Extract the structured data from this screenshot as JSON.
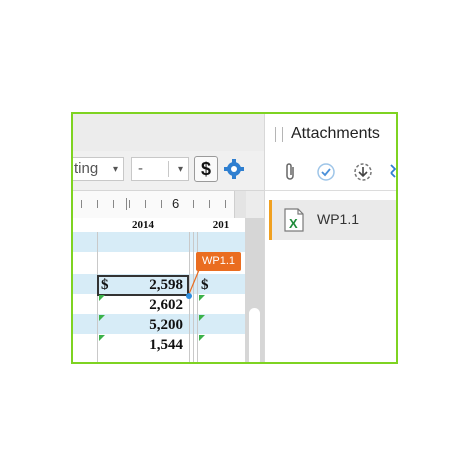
{
  "toolbar": {
    "format_select_value": "ting",
    "dash_select_value": "-",
    "currency_button_label": "$",
    "dropdown_arrow": "▾"
  },
  "ruler": {
    "marker": "6"
  },
  "sheet": {
    "columns": [
      "2014",
      "201"
    ],
    "cells": [
      {
        "prefix": "$",
        "value": "2,598",
        "right_prefix": "$"
      },
      {
        "prefix": "",
        "value": "2,602"
      },
      {
        "prefix": "",
        "value": "5,200"
      },
      {
        "prefix": "",
        "value": "1,544"
      }
    ],
    "row_highlight_color": "#d7ecf7",
    "flag_color": "#3cb24a"
  },
  "tag": {
    "label": "WP1.1",
    "color": "#ea6d20"
  },
  "attachments_panel": {
    "title": "Attachments",
    "tools": [
      "paperclip-icon",
      "signoff-check-icon",
      "download-icon",
      "more-icon"
    ],
    "items": [
      {
        "label": "WP1.1",
        "icon": "excel-file-icon"
      }
    ]
  },
  "frame_color": "#7ed321"
}
